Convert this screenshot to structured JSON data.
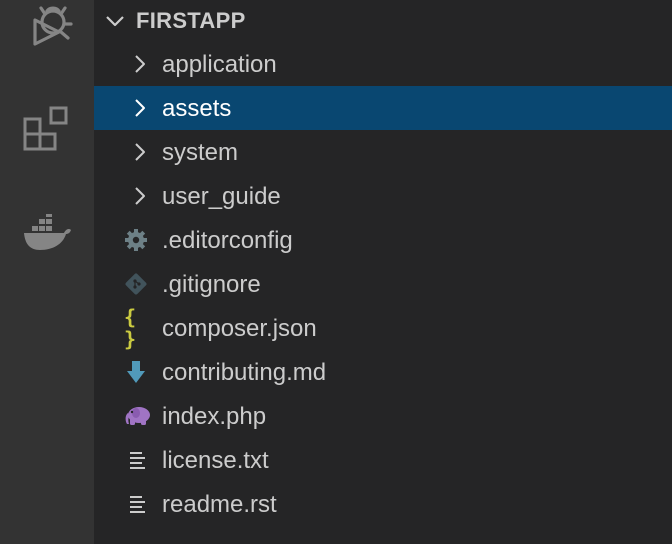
{
  "explorer": {
    "project_title": "FIRSTAPP",
    "folders": [
      {
        "label": "application",
        "selected": false
      },
      {
        "label": "assets",
        "selected": true
      },
      {
        "label": "system",
        "selected": false
      },
      {
        "label": "user_guide",
        "selected": false
      }
    ],
    "files": [
      {
        "label": ".editorconfig",
        "icon": "gear-icon"
      },
      {
        "label": ".gitignore",
        "icon": "git-icon"
      },
      {
        "label": "composer.json",
        "icon": "json-braces-icon"
      },
      {
        "label": "contributing.md",
        "icon": "markdown-arrow-icon"
      },
      {
        "label": "index.php",
        "icon": "php-elephant-icon"
      },
      {
        "label": "license.txt",
        "icon": "text-lines-icon"
      },
      {
        "label": "readme.rst",
        "icon": "text-lines-icon"
      }
    ],
    "json_braces": "{ }"
  },
  "activity_bar": {
    "items": [
      "debug-icon",
      "extensions-icon",
      "docker-icon"
    ]
  },
  "colors": {
    "activity_bar_bg": "#333333",
    "sidebar_bg": "#252526",
    "selection_bg": "#094771",
    "text": "#cccccc",
    "icon_inactive": "#858585",
    "gear": "#6d8086",
    "git": "#41535b",
    "json": "#cbcb41",
    "markdown": "#519aba",
    "php": "#a074c4"
  }
}
